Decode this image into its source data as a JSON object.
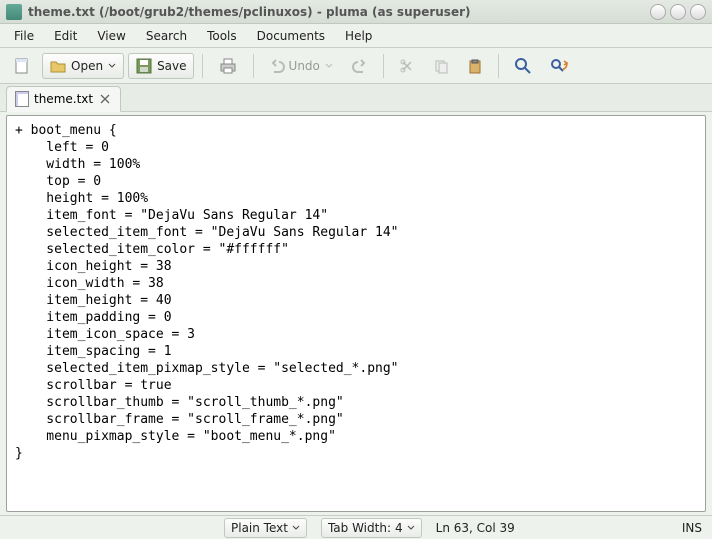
{
  "window": {
    "title": "theme.txt (/boot/grub2/themes/pclinuxos) - pluma (as superuser)"
  },
  "menubar": {
    "file": "File",
    "edit": "Edit",
    "view": "View",
    "search": "Search",
    "tools": "Tools",
    "documents": "Documents",
    "help": "Help"
  },
  "toolbar": {
    "open": "Open",
    "save": "Save",
    "undo": "Undo"
  },
  "tab": {
    "label": "theme.txt"
  },
  "editor": {
    "content": "+ boot_menu {\n    left = 0\n    width = 100%\n    top = 0\n    height = 100%\n    item_font = \"DejaVu Sans Regular 14\"\n    selected_item_font = \"DejaVu Sans Regular 14\"\n    selected_item_color = \"#ffffff\"\n    icon_height = 38\n    icon_width = 38\n    item_height = 40\n    item_padding = 0\n    item_icon_space = 3\n    item_spacing = 1\n    selected_item_pixmap_style = \"selected_*.png\"\n    scrollbar = true\n    scrollbar_thumb = \"scroll_thumb_*.png\"\n    scrollbar_frame = \"scroll_frame_*.png\"\n    menu_pixmap_style = \"boot_menu_*.png\"\n}"
  },
  "statusbar": {
    "lang": "Plain Text",
    "tabwidth_label": "Tab Width:",
    "tabwidth_value": "4",
    "position": "Ln 63, Col 39",
    "insert_mode": "INS"
  }
}
